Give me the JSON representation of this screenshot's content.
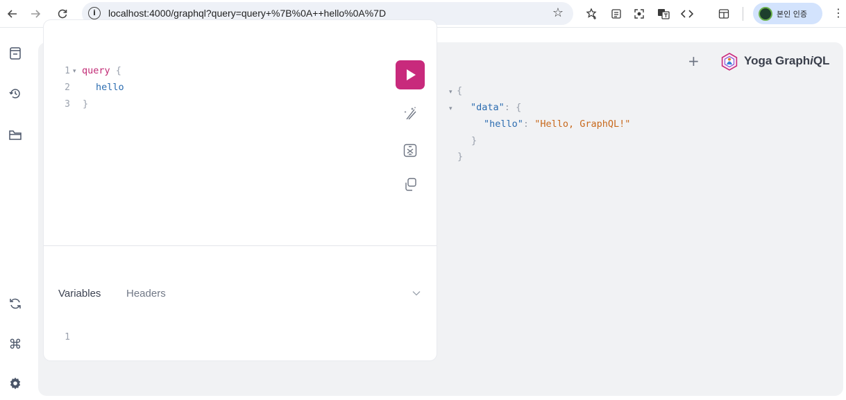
{
  "browser": {
    "url": "localhost:4000/graphql?query=query+%7B%0A++hello%0A%7D",
    "profile_label": "본인 인증"
  },
  "app": {
    "title_prefix": "Yoga Graph",
    "title_italic": "i",
    "title_suffix": "QL"
  },
  "editor": {
    "line_numbers": [
      "1",
      "2",
      "3"
    ],
    "line1_keyword": "query",
    "line1_brace": "{",
    "line2_field": "hello",
    "line3_brace": "}"
  },
  "variables_panel": {
    "tabs": [
      "Variables",
      "Headers"
    ],
    "line_number": "1"
  },
  "result": {
    "open_brace": "{",
    "data_key": "\"data\"",
    "colon": ":",
    "data_open": "{",
    "hello_key": "\"hello\"",
    "hello_value": "\"Hello, GraphQL!\"",
    "data_close": "}",
    "close_brace": "}"
  }
}
